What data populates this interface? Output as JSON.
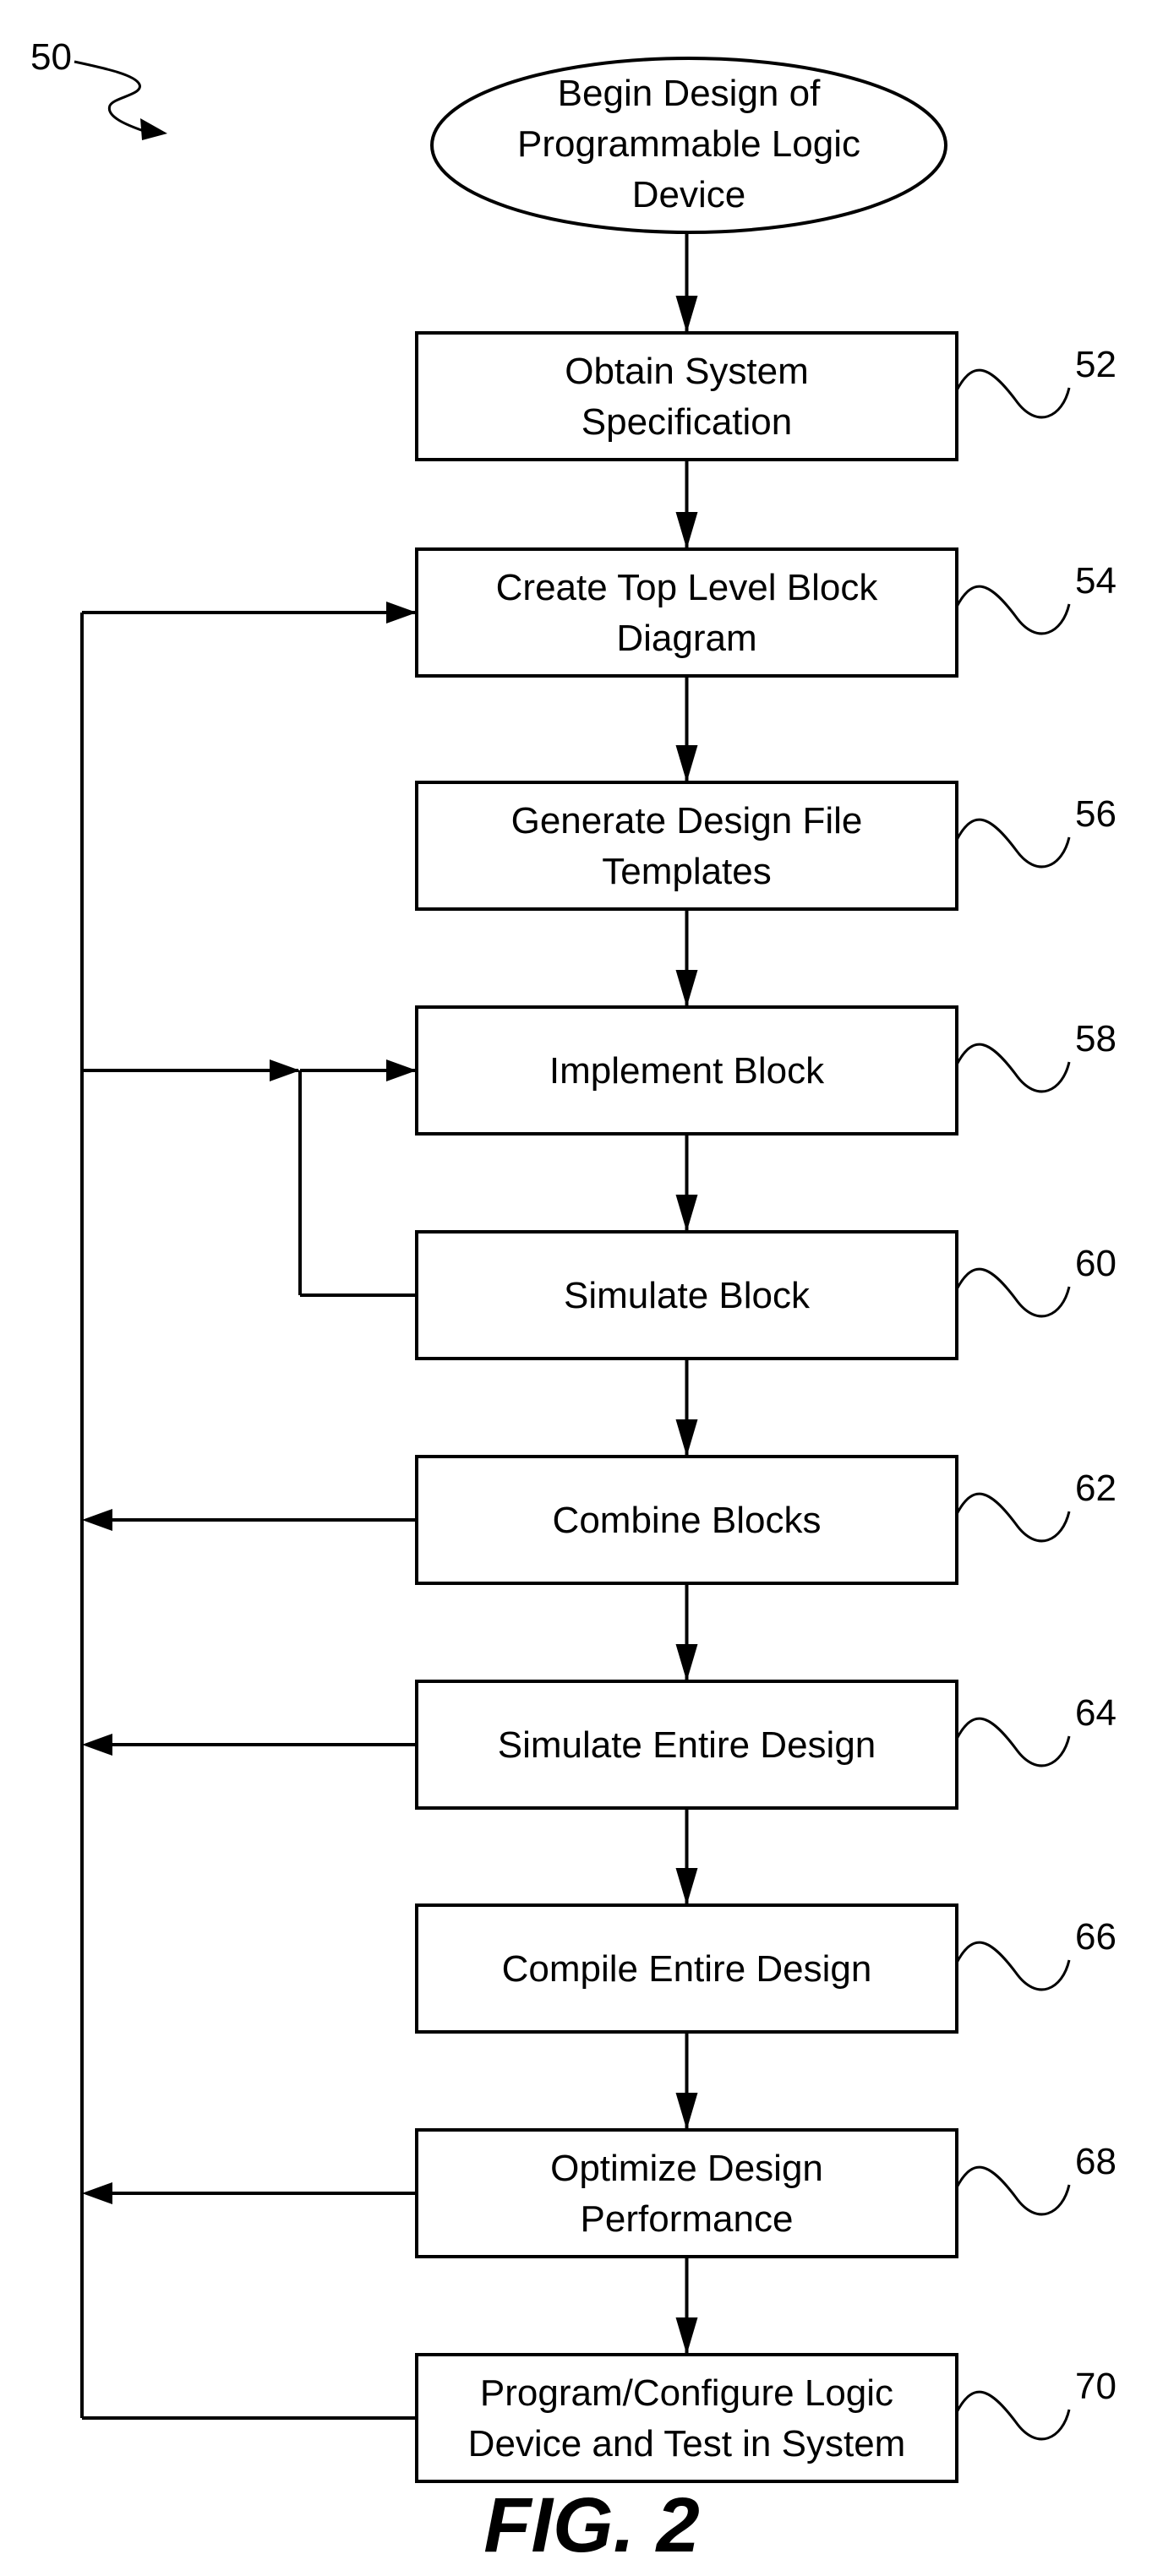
{
  "figure": {
    "caption": "FIG. 2",
    "reference": "50"
  },
  "start": {
    "lines": [
      "Begin Design of",
      "Programmable Logic",
      "Device"
    ]
  },
  "steps": [
    {
      "id": "52",
      "lines": [
        "Obtain System",
        "Specification"
      ]
    },
    {
      "id": "54",
      "lines": [
        "Create Top Level Block",
        "Diagram"
      ]
    },
    {
      "id": "56",
      "lines": [
        "Generate Design File",
        "Templates"
      ]
    },
    {
      "id": "58",
      "lines": [
        "Implement Block"
      ]
    },
    {
      "id": "60",
      "lines": [
        "Simulate Block"
      ]
    },
    {
      "id": "62",
      "lines": [
        "Combine Blocks"
      ]
    },
    {
      "id": "64",
      "lines": [
        "Simulate Entire Design"
      ]
    },
    {
      "id": "66",
      "lines": [
        "Compile Entire Design"
      ]
    },
    {
      "id": "68",
      "lines": [
        "Optimize Design",
        "Performance"
      ]
    },
    {
      "id": "70",
      "lines": [
        "Program/Configure Logic",
        "Device and Test in System"
      ]
    }
  ],
  "edges": [
    {
      "from": "start",
      "to": "52",
      "type": "sequence"
    },
    {
      "from": "52",
      "to": "54",
      "type": "sequence"
    },
    {
      "from": "54",
      "to": "56",
      "type": "sequence"
    },
    {
      "from": "56",
      "to": "58",
      "type": "sequence"
    },
    {
      "from": "58",
      "to": "60",
      "type": "sequence"
    },
    {
      "from": "60",
      "to": "62",
      "type": "sequence"
    },
    {
      "from": "62",
      "to": "64",
      "type": "sequence"
    },
    {
      "from": "64",
      "to": "66",
      "type": "sequence"
    },
    {
      "from": "66",
      "to": "68",
      "type": "sequence"
    },
    {
      "from": "68",
      "to": "70",
      "type": "sequence"
    },
    {
      "from": "60",
      "to": "58",
      "type": "local-feedback"
    },
    {
      "from": "62",
      "to": "feedback-bus",
      "type": "feedback"
    },
    {
      "from": "64",
      "to": "feedback-bus",
      "type": "feedback"
    },
    {
      "from": "68",
      "to": "feedback-bus",
      "type": "feedback"
    },
    {
      "from": "70",
      "to": "feedback-bus",
      "type": "feedback"
    },
    {
      "from": "feedback-bus",
      "to": "54",
      "type": "feedback"
    },
    {
      "from": "feedback-bus",
      "to": "58",
      "type": "feedback"
    }
  ]
}
